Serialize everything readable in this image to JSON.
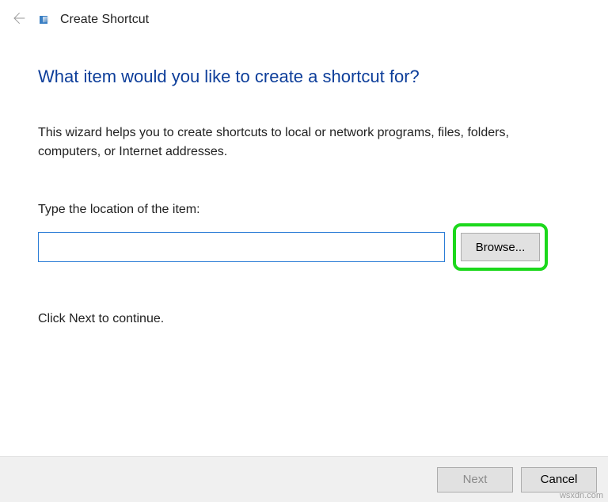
{
  "titlebar": {
    "title": "Create Shortcut"
  },
  "main": {
    "heading": "What item would you like to create a shortcut for?",
    "description": "This wizard helps you to create shortcuts to local or network programs, files, folders, computers, or Internet addresses.",
    "location_label": "Type the location of the item:",
    "location_value": "",
    "browse_label": "Browse...",
    "continue_hint": "Click Next to continue."
  },
  "footer": {
    "next_label": "Next",
    "cancel_label": "Cancel",
    "next_enabled": false
  },
  "watermark": "wsxdn.com"
}
